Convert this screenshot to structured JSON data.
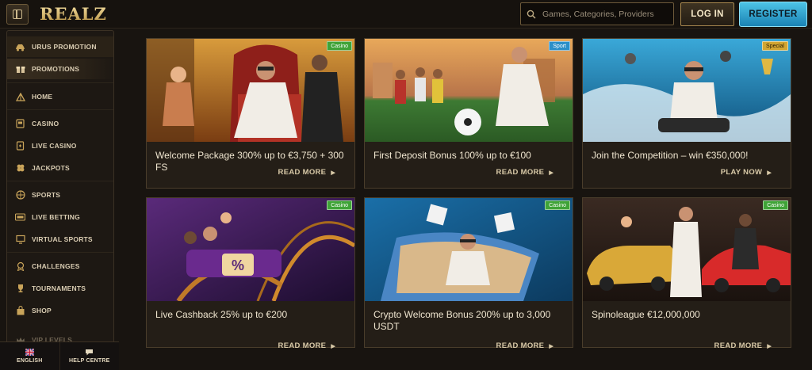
{
  "brand": {
    "logo_text": "REALZ"
  },
  "header": {
    "search_placeholder": "Games, Categories, Providers",
    "login_label": "LOG IN",
    "register_label": "REGISTER"
  },
  "sidebar": {
    "items": [
      {
        "label": "URUS PROMOTION",
        "icon": "car-icon"
      },
      {
        "label": "PROMOTIONS",
        "icon": "gift-icon"
      },
      {
        "label": "HOME",
        "icon": "pyramid-icon"
      },
      {
        "label": "CASINO",
        "icon": "slot-machine-icon"
      },
      {
        "label": "LIVE CASINO",
        "icon": "cards-icon"
      },
      {
        "label": "JACKPOTS",
        "icon": "clover-icon"
      },
      {
        "label": "SPORTS",
        "icon": "ball-icon"
      },
      {
        "label": "LIVE BETTING",
        "icon": "live-icon"
      },
      {
        "label": "VIRTUAL SPORTS",
        "icon": "monitor-icon"
      },
      {
        "label": "CHALLENGES",
        "icon": "badge-icon"
      },
      {
        "label": "TOURNAMENTS",
        "icon": "trophy-icon"
      },
      {
        "label": "SHOP",
        "icon": "bag-icon"
      },
      {
        "label": "VIP LEVELS",
        "icon": "crown-icon"
      }
    ],
    "bottom": {
      "language_label": "ENGLISH",
      "help_label": "HELP CENTRE"
    }
  },
  "promotions": [
    {
      "badge": "Casino",
      "title": "Welcome Package 300% up to €3,750 + 300 FS",
      "cta": "READ MORE"
    },
    {
      "badge": "Sport",
      "title": "First Deposit Bonus 100% up to €100",
      "cta": "READ MORE"
    },
    {
      "badge": "Special",
      "title": "Join the Competition – win €350,000!",
      "cta": "PLAY NOW"
    },
    {
      "badge": "Casino",
      "title": "Live Cashback 25% up to €200",
      "cta": "READ MORE"
    },
    {
      "badge": "Casino",
      "title": "Crypto Welcome Bonus 200% up to 3,000 USDT",
      "cta": "READ MORE"
    },
    {
      "badge": "Casino",
      "title": "Spinoleague €12,000,000",
      "cta": "READ MORE"
    }
  ],
  "colors": {
    "background": "#181410",
    "gold_accent": "#c9a45a",
    "register_blue": "#2fa3d4",
    "badge_casino": "#3fa337",
    "badge_sport": "#2b8fc8",
    "badge_special": "#d3a632"
  }
}
